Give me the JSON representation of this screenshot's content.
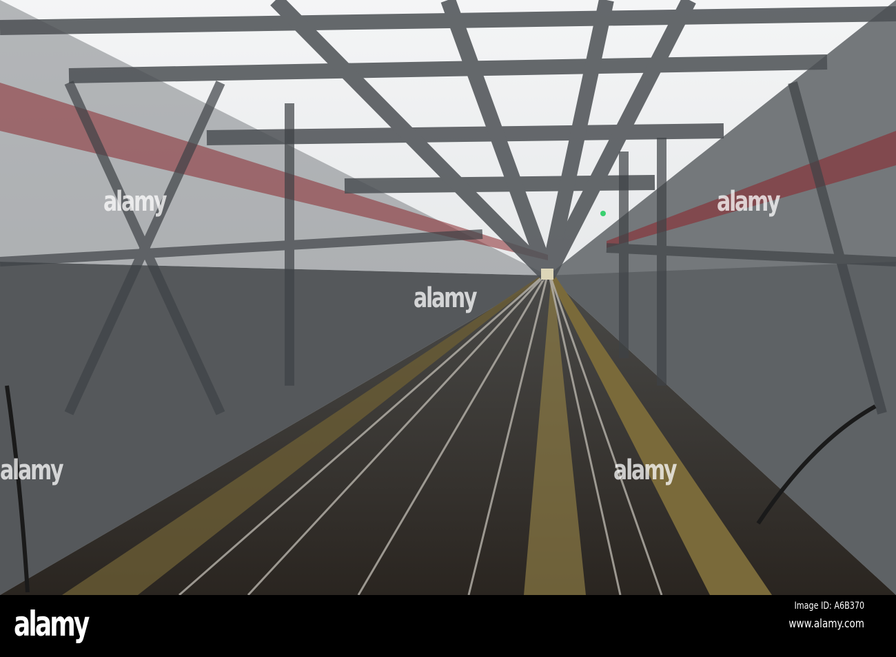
{
  "watermark": {
    "text": "alamy"
  },
  "footer": {
    "logo": "alamy",
    "image_id": "Image ID: A6B370",
    "website": "www.alamy.com"
  },
  "colors": {
    "steel": "#5a5d60",
    "sky": "#eef0f1",
    "rail_red": "#8a2a30",
    "track_yellow": "#7a6a3a"
  }
}
